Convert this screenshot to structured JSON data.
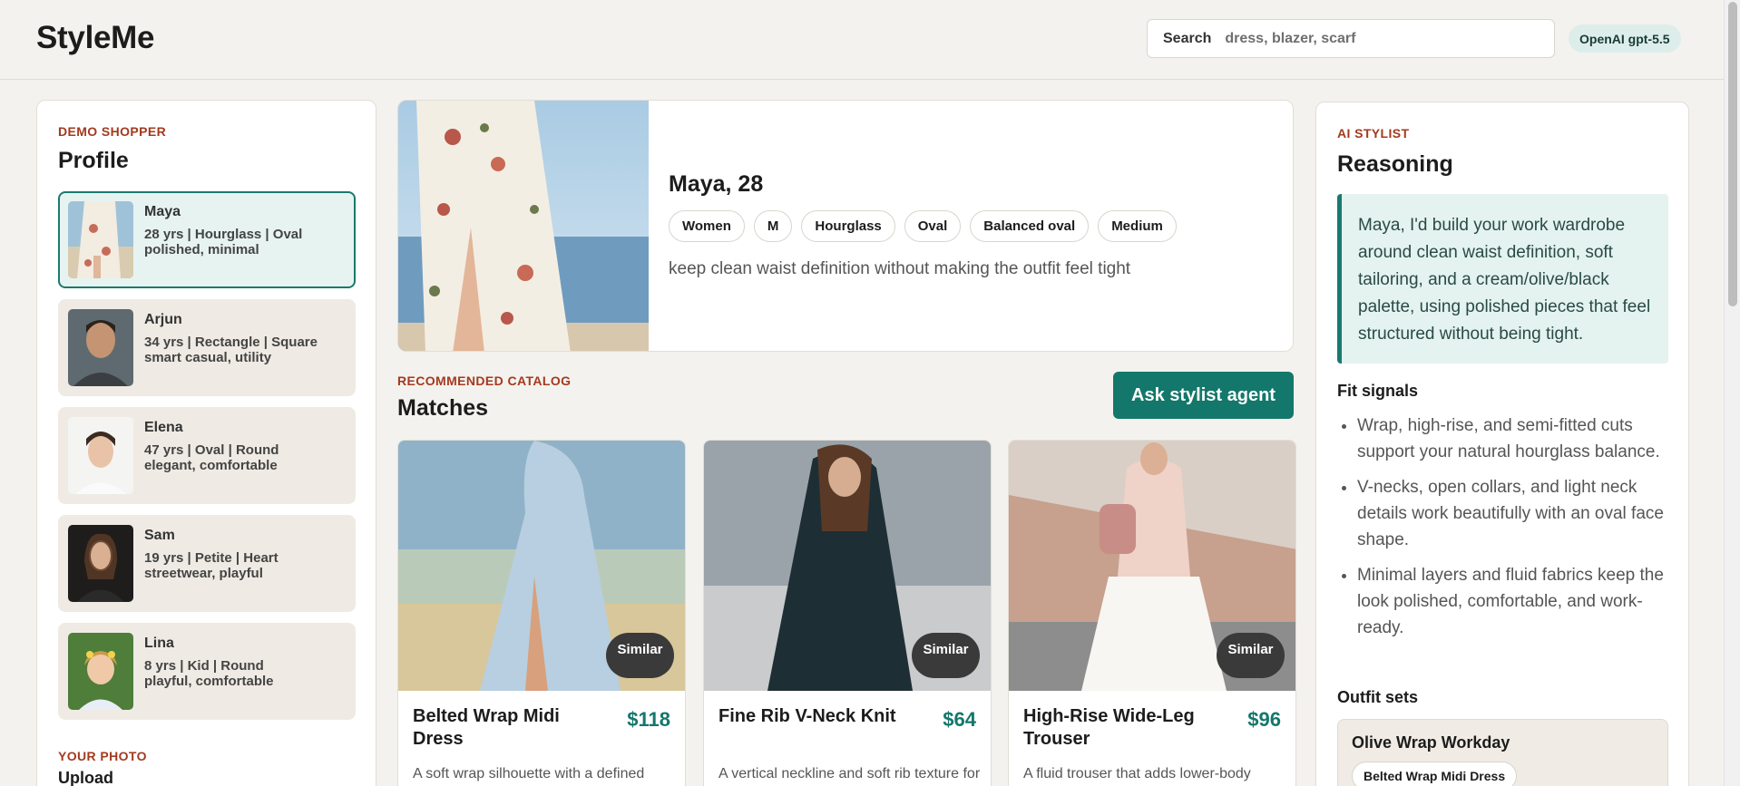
{
  "header": {
    "logo": "StyleMe",
    "search_label": "Search",
    "search_placeholder": "dress, blazer, scarf",
    "model_badge": "OpenAI gpt-5.5"
  },
  "profile_panel": {
    "eyebrow": "DEMO SHOPPER",
    "title": "Profile",
    "profiles": [
      {
        "name": "Maya",
        "line1": "28 yrs | Hourglass | Oval",
        "line2": "polished, minimal"
      },
      {
        "name": "Arjun",
        "line1": "34 yrs | Rectangle | Square",
        "line2": "smart casual, utility"
      },
      {
        "name": "Elena",
        "line1": "47 yrs | Oval | Round",
        "line2": "elegant, comfortable"
      },
      {
        "name": "Sam",
        "line1": "19 yrs | Petite | Heart",
        "line2": "streetwear, playful"
      },
      {
        "name": "Lina",
        "line1": "8 yrs | Kid | Round",
        "line2": "playful, comfortable"
      }
    ],
    "photo_eyebrow": "YOUR PHOTO",
    "upload_label": "Upload"
  },
  "hero": {
    "name": "Maya, 28",
    "chips": [
      "Women",
      "M",
      "Hourglass",
      "Oval",
      "Balanced oval",
      "Medium"
    ],
    "goal": "keep clean waist definition without making the outfit feel tight"
  },
  "catalog": {
    "eyebrow": "RECOMMENDED CATALOG",
    "title": "Matches",
    "ask_button": "Ask stylist agent",
    "similar_label": "Similar",
    "products": [
      {
        "name": "Belted Wrap Midi Dress",
        "price": "$118",
        "desc": "A soft wrap silhouette with a defined"
      },
      {
        "name": "Fine Rib V-Neck Knit",
        "price": "$64",
        "desc": "A vertical neckline and soft rib texture for everyday layering."
      },
      {
        "name": "High-Rise Wide-Leg Trouser",
        "price": "$96",
        "desc": "A fluid trouser that adds lower-body"
      }
    ]
  },
  "stylist": {
    "eyebrow": "AI STYLIST",
    "title": "Reasoning",
    "reasoning": "Maya, I'd build your work wardrobe around clean waist definition, soft tailoring, and a cream/olive/black palette, using polished pieces that feel structured without being tight.",
    "fit_title": "Fit signals",
    "fit_signals": [
      "Wrap, high-rise, and semi-fitted cuts support your natural hourglass balance.",
      "V-necks, open collars, and light neck details work beautifully with an oval face shape.",
      "Minimal layers and fluid fabrics keep the look polished, comfortable, and work-ready."
    ],
    "outfit_title": "Outfit sets",
    "outfit_name": "Olive Wrap Workday",
    "outfit_item": "Belted Wrap Midi Dress"
  }
}
